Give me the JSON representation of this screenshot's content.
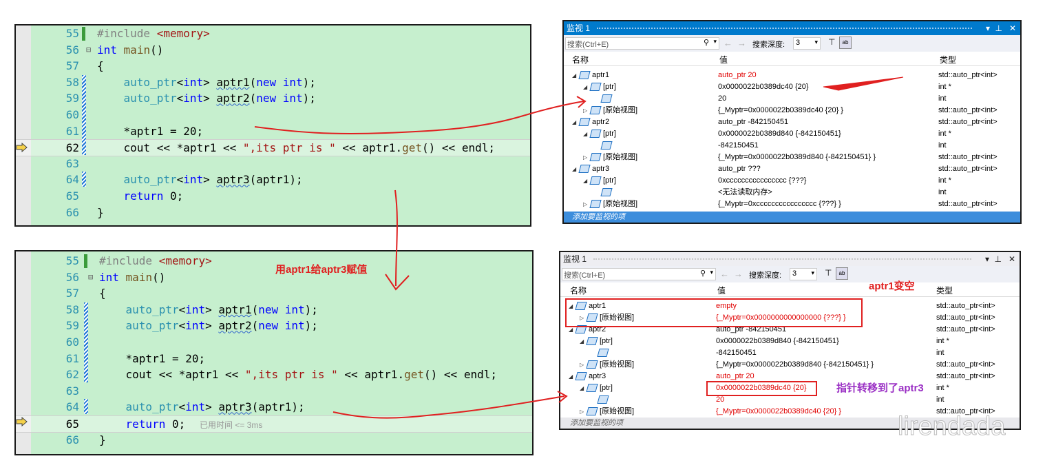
{
  "top_code": {
    "lines": [
      {
        "num": "55",
        "parts": [
          [
            "pp",
            "#include "
          ],
          [
            "inc",
            "<memory>"
          ]
        ]
      },
      {
        "num": "56",
        "parts": [
          [
            "kw",
            "int"
          ],
          [
            "id",
            " "
          ],
          [
            "fn",
            "main"
          ],
          [
            "id",
            "()"
          ]
        ]
      },
      {
        "num": "57",
        "parts": [
          [
            "id",
            "{"
          ]
        ]
      },
      {
        "num": "58",
        "parts": [
          [
            "id",
            "    "
          ],
          [
            "t",
            "auto_ptr"
          ],
          [
            "id",
            "<"
          ],
          [
            "kw",
            "int"
          ],
          [
            "id",
            "> "
          ],
          [
            "sq",
            "aptr1"
          ],
          [
            "id",
            "("
          ],
          [
            "kw",
            "new int"
          ],
          [
            "id",
            ");"
          ]
        ]
      },
      {
        "num": "59",
        "parts": [
          [
            "id",
            "    "
          ],
          [
            "t",
            "auto_ptr"
          ],
          [
            "id",
            "<"
          ],
          [
            "kw",
            "int"
          ],
          [
            "id",
            "> "
          ],
          [
            "sq",
            "aptr2"
          ],
          [
            "id",
            "("
          ],
          [
            "kw",
            "new int"
          ],
          [
            "id",
            ");"
          ]
        ]
      },
      {
        "num": "60",
        "parts": []
      },
      {
        "num": "61",
        "parts": [
          [
            "id",
            "    *aptr1 = 20;"
          ]
        ]
      },
      {
        "num": "62",
        "parts": [
          [
            "id",
            "    cout << *aptr1 << "
          ],
          [
            "str",
            "\",its ptr is \""
          ],
          [
            "id",
            " << aptr1."
          ],
          [
            "fn",
            "get"
          ],
          [
            "id",
            "() << endl;"
          ]
        ]
      },
      {
        "num": "63",
        "parts": []
      },
      {
        "num": "64",
        "parts": [
          [
            "id",
            "    "
          ],
          [
            "t",
            "auto_ptr"
          ],
          [
            "id",
            "<"
          ],
          [
            "kw",
            "int"
          ],
          [
            "id",
            "> "
          ],
          [
            "sq",
            "aptr3"
          ],
          [
            "id",
            "(aptr1);"
          ]
        ]
      },
      {
        "num": "65",
        "parts": [
          [
            "id",
            "    "
          ],
          [
            "kw",
            "return"
          ],
          [
            "id",
            " 0;"
          ]
        ]
      },
      {
        "num": "66",
        "parts": [
          [
            "id",
            "}"
          ]
        ]
      }
    ],
    "current_line": "62"
  },
  "bottom_code": {
    "current_line": "65",
    "elapsed_hint": "已用时间 <= 3ms"
  },
  "watch_top": {
    "title": "监视 1",
    "search_placeholder": "搜索(Ctrl+E)",
    "depth_label": "搜索深度:",
    "depth_value": "3",
    "col_name": "名称",
    "col_value": "值",
    "col_type": "类型",
    "rows": [
      {
        "indent": 0,
        "tri": "◢",
        "name": "aptr1",
        "value": "auto_ptr 20",
        "type": "std::auto_ptr<int>",
        "red": true
      },
      {
        "indent": 1,
        "tri": "◢",
        "name": "[ptr]",
        "value": "0x0000022b0389dc40 {20}",
        "type": "int *"
      },
      {
        "indent": 2,
        "tri": "",
        "name": "",
        "value": "20",
        "type": "int"
      },
      {
        "indent": 1,
        "tri": "▷",
        "name": "[原始视图]",
        "value": "{_Myptr=0x0000022b0389dc40 {20} }",
        "type": "std::auto_ptr<int>"
      },
      {
        "indent": 0,
        "tri": "◢",
        "name": "aptr2",
        "value": "auto_ptr -842150451",
        "type": "std::auto_ptr<int>"
      },
      {
        "indent": 1,
        "tri": "◢",
        "name": "[ptr]",
        "value": "0x0000022b0389d840 {-842150451}",
        "type": "int *"
      },
      {
        "indent": 2,
        "tri": "",
        "name": "",
        "value": "-842150451",
        "type": "int"
      },
      {
        "indent": 1,
        "tri": "▷",
        "name": "[原始视图]",
        "value": "{_Myptr=0x0000022b0389d840 {-842150451} }",
        "type": "std::auto_ptr<int>"
      },
      {
        "indent": 0,
        "tri": "◢",
        "name": "aptr3",
        "value": "auto_ptr ???",
        "type": "std::auto_ptr<int>"
      },
      {
        "indent": 1,
        "tri": "◢",
        "name": "[ptr]",
        "value": "0xcccccccccccccccc {???}",
        "type": "int *"
      },
      {
        "indent": 2,
        "tri": "",
        "name": "",
        "value": "<无法读取内存>",
        "type": "int"
      },
      {
        "indent": 1,
        "tri": "▷",
        "name": "[原始视图]",
        "value": "{_Myptr=0xcccccccccccccccc {???} }",
        "type": "std::auto_ptr<int>"
      }
    ],
    "footer": "添加要监视的项"
  },
  "watch_bottom": {
    "title": "监视 1",
    "search_placeholder": "搜索(Ctrl+E)",
    "depth_label": "搜索深度:",
    "depth_value": "3",
    "col_name": "名称",
    "col_value": "值",
    "col_type": "类型",
    "rows": [
      {
        "indent": 0,
        "tri": "◢",
        "name": "aptr1",
        "value": "empty",
        "type": "std::auto_ptr<int>",
        "red": true
      },
      {
        "indent": 1,
        "tri": "▷",
        "name": "[原始视图]",
        "value": "{_Myptr=0x0000000000000000 {???} }",
        "type": "std::auto_ptr<int>",
        "red": true
      },
      {
        "indent": 0,
        "tri": "◢",
        "name": "aptr2",
        "value": "auto_ptr -842150451",
        "type": "std::auto_ptr<int>"
      },
      {
        "indent": 1,
        "tri": "◢",
        "name": "[ptr]",
        "value": "0x0000022b0389d840 {-842150451}",
        "type": "int *"
      },
      {
        "indent": 2,
        "tri": "",
        "name": "",
        "value": "-842150451",
        "type": "int"
      },
      {
        "indent": 1,
        "tri": "▷",
        "name": "[原始视图]",
        "value": "{_Myptr=0x0000022b0389d840 {-842150451} }",
        "type": "std::auto_ptr<int>"
      },
      {
        "indent": 0,
        "tri": "◢",
        "name": "aptr3",
        "value": "auto_ptr 20",
        "type": "std::auto_ptr<int>",
        "red": true
      },
      {
        "indent": 1,
        "tri": "◢",
        "name": "[ptr]",
        "value": "0x0000022b0389dc40 {20}",
        "type": "int *",
        "red": true
      },
      {
        "indent": 2,
        "tri": "",
        "name": "",
        "value": "20",
        "type": "int",
        "red": true
      },
      {
        "indent": 1,
        "tri": "▷",
        "name": "[原始视图]",
        "value": "{_Myptr=0x0000022b0389dc40 {20} }",
        "type": "std::auto_ptr<int>",
        "red": true
      }
    ],
    "footer": "添加要监视的项"
  },
  "annotations": {
    "assign_note": "用aptr1给aptr3赋值",
    "empty_note": "aptr1变空",
    "move_note": "指针转移到了aptr3",
    "watermark": "lirendada"
  },
  "colors": {
    "annot_red": "#e02020",
    "annot_purple": "#9a2fc4",
    "title_blue": "#007acc"
  }
}
